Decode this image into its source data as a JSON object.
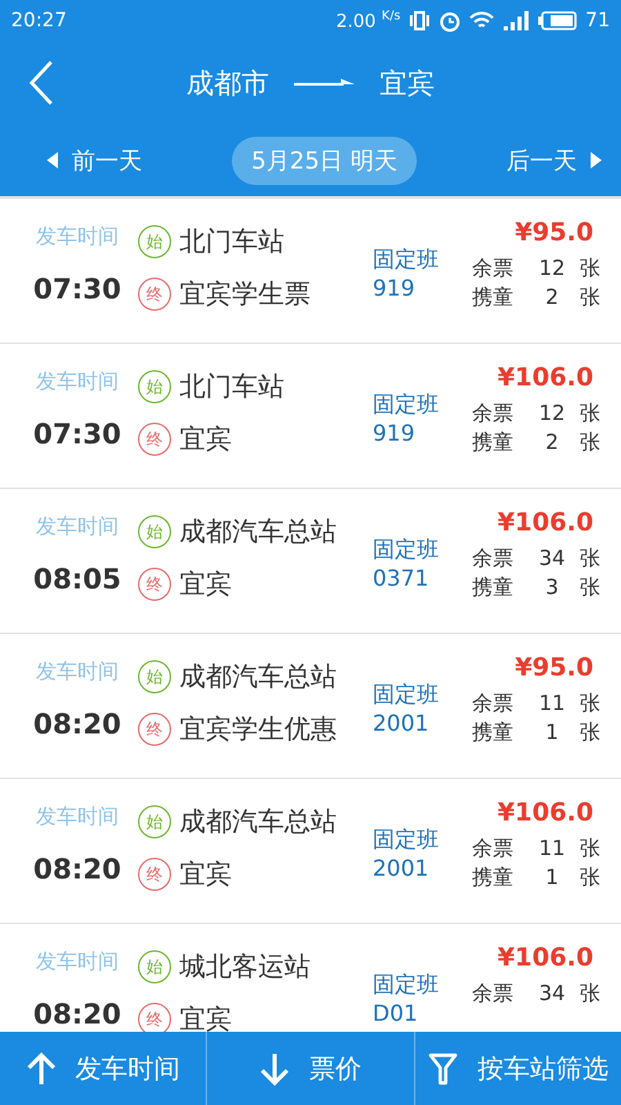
{
  "status_bar": {
    "time": "20:27",
    "speed": "2.00",
    "speed_unit": "K/s",
    "battery": "71"
  },
  "header": {
    "from": "成都市",
    "to": "宜宾"
  },
  "date_bar": {
    "prev": "前一天",
    "current": "5月25日 明天",
    "next": "后一天"
  },
  "trips": [
    {
      "time_label": "发车时间",
      "time": "07:30",
      "start_mark": "始",
      "start": "北门车站",
      "end_mark": "终",
      "end": "宜宾学生票",
      "type": "固定班",
      "number": "919",
      "price": "¥95.0",
      "seats_label": "余票",
      "seats": "12",
      "seats_unit": "张",
      "kids_label": "携童",
      "kids": "2",
      "kids_unit": "张"
    },
    {
      "time_label": "发车时间",
      "time": "07:30",
      "start_mark": "始",
      "start": "北门车站",
      "end_mark": "终",
      "end": "宜宾",
      "type": "固定班",
      "number": "919",
      "price": "¥106.0",
      "seats_label": "余票",
      "seats": "12",
      "seats_unit": "张",
      "kids_label": "携童",
      "kids": "2",
      "kids_unit": "张"
    },
    {
      "time_label": "发车时间",
      "time": "08:05",
      "start_mark": "始",
      "start": "成都汽车总站",
      "end_mark": "终",
      "end": "宜宾",
      "type": "固定班",
      "number": "0371",
      "price": "¥106.0",
      "seats_label": "余票",
      "seats": "34",
      "seats_unit": "张",
      "kids_label": "携童",
      "kids": "3",
      "kids_unit": "张"
    },
    {
      "time_label": "发车时间",
      "time": "08:20",
      "start_mark": "始",
      "start": "成都汽车总站",
      "end_mark": "终",
      "end": "宜宾学生优惠",
      "type": "固定班",
      "number": "2001",
      "price": "¥95.0",
      "seats_label": "余票",
      "seats": "11",
      "seats_unit": "张",
      "kids_label": "携童",
      "kids": "1",
      "kids_unit": "张"
    },
    {
      "time_label": "发车时间",
      "time": "08:20",
      "start_mark": "始",
      "start": "成都汽车总站",
      "end_mark": "终",
      "end": "宜宾",
      "type": "固定班",
      "number": "2001",
      "price": "¥106.0",
      "seats_label": "余票",
      "seats": "11",
      "seats_unit": "张",
      "kids_label": "携童",
      "kids": "1",
      "kids_unit": "张"
    },
    {
      "time_label": "发车时间",
      "time": "08:20",
      "start_mark": "始",
      "start": "城北客运站",
      "end_mark": "终",
      "end": "宜宾",
      "type": "固定班",
      "number": "D01",
      "price": "¥106.0",
      "seats_label": "余票",
      "seats": "34",
      "seats_unit": "张"
    }
  ],
  "toolbar": [
    {
      "kind": "up",
      "label": "发车时间"
    },
    {
      "kind": "down",
      "label": "票价"
    },
    {
      "kind": "filter",
      "label": "按车站筛选"
    }
  ]
}
